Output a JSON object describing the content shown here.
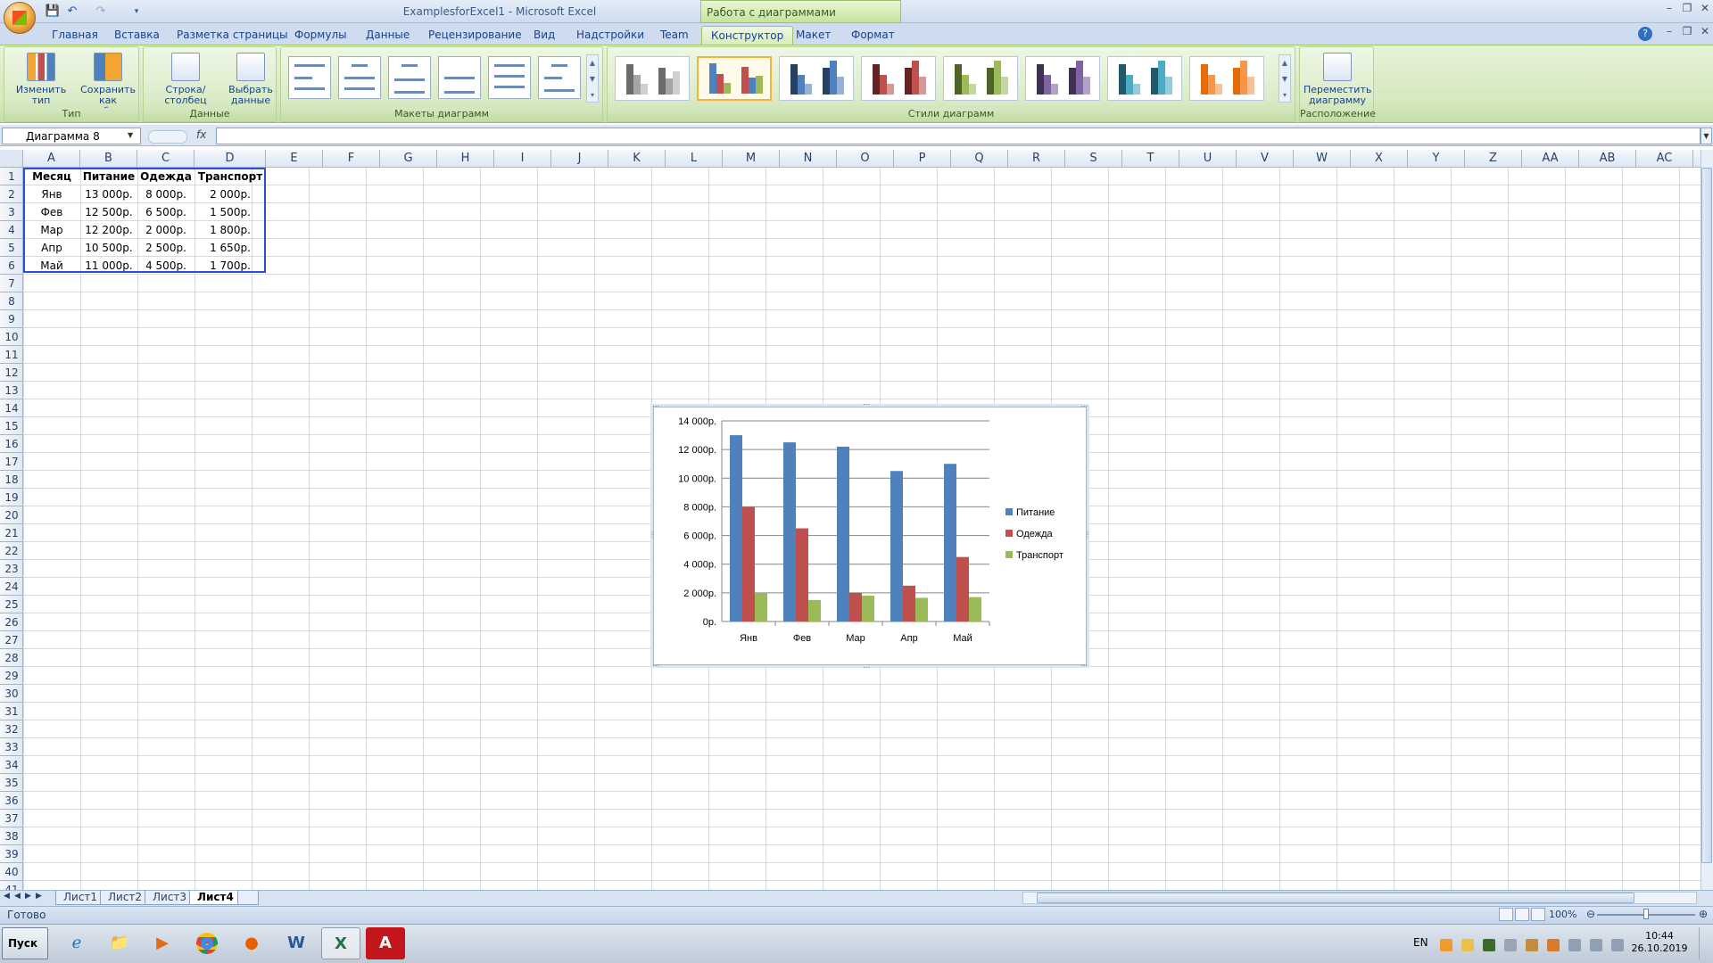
{
  "window": {
    "title": "ExamplesforExcel1 - Microsoft Excel",
    "context_header": "Работа с диаграммами"
  },
  "tabs": [
    "Главная",
    "Вставка",
    "Разметка страницы",
    "Формулы",
    "Данные",
    "Рецензирование",
    "Вид",
    "Надстройки",
    "Team",
    "Конструктор",
    "Макет",
    "Формат"
  ],
  "active_tab": "Конструктор",
  "ribbon": {
    "type_group": {
      "label": "Тип",
      "change_type": "Изменить тип диаграммы",
      "save_template": "Сохранить как шаблон"
    },
    "data_group": {
      "label": "Данные",
      "switch_row_col": "Строка/столбец",
      "select_data": "Выбрать данные"
    },
    "layouts_group": {
      "label": "Макеты диаграмм"
    },
    "styles_group": {
      "label": "Стили диаграмм"
    },
    "location_group": {
      "label": "Расположение",
      "move_chart": "Переместить диаграмму"
    }
  },
  "formula_bar": {
    "name_box": "Диаграмма 8",
    "fx": "fx",
    "value": ""
  },
  "columns": [
    "A",
    "B",
    "C",
    "D",
    "E",
    "F",
    "G",
    "H",
    "I",
    "J",
    "K",
    "L",
    "M",
    "N",
    "O",
    "P",
    "Q",
    "R",
    "S",
    "T",
    "U",
    "V",
    "W",
    "X",
    "Y",
    "Z",
    "AA",
    "AB",
    "AC"
  ],
  "rows": [
    "1",
    "2",
    "3",
    "4",
    "5",
    "6",
    "7",
    "8",
    "9",
    "10",
    "11",
    "12",
    "13",
    "14",
    "15",
    "16",
    "17",
    "18",
    "19",
    "20",
    "21",
    "22",
    "23",
    "24",
    "25",
    "26",
    "27",
    "28",
    "29",
    "30",
    "31",
    "32",
    "33",
    "34",
    "35",
    "36",
    "37",
    "38",
    "39",
    "40",
    "41"
  ],
  "table": {
    "headers": [
      "Месяц",
      "Питание",
      "Одежда",
      "Транспорт"
    ],
    "rows": [
      [
        "Янв",
        "13 000р.",
        "8 000р.",
        "2 000р."
      ],
      [
        "Фев",
        "12 500р.",
        "6 500р.",
        "1 500р."
      ],
      [
        "Мар",
        "12 200р.",
        "2 000р.",
        "1 800р."
      ],
      [
        "Апр",
        "10 500р.",
        "2 500р.",
        "1 650р."
      ],
      [
        "Май",
        "11 000р.",
        "4 500р.",
        "1 700р."
      ]
    ]
  },
  "sheets": [
    "Лист1",
    "Лист2",
    "Лист3",
    "Лист4"
  ],
  "active_sheet": "Лист4",
  "status": {
    "text": "Готово",
    "zoom": "100%"
  },
  "taskbar": {
    "start": "Пуск",
    "lang": "EN",
    "time": "10:44",
    "date": "26.10.2019"
  },
  "colors": {
    "series1": "#4f81bd",
    "series2": "#c0504d",
    "series3": "#9bbb59"
  },
  "chart_data": {
    "type": "bar",
    "categories": [
      "Янв",
      "Фев",
      "Мар",
      "Апр",
      "Май"
    ],
    "series": [
      {
        "name": "Питание",
        "values": [
          13000,
          12500,
          12200,
          10500,
          11000
        ]
      },
      {
        "name": "Одежда",
        "values": [
          8000,
          6500,
          2000,
          2500,
          4500
        ]
      },
      {
        "name": "Транспорт",
        "values": [
          2000,
          1500,
          1800,
          1650,
          1700
        ]
      }
    ],
    "yticks": [
      "0р.",
      "2 000р.",
      "4 000р.",
      "6 000р.",
      "8 000р.",
      "10 000р.",
      "12 000р.",
      "14 000р."
    ],
    "ylim": [
      0,
      14000
    ],
    "grid": true,
    "legend": "right"
  }
}
